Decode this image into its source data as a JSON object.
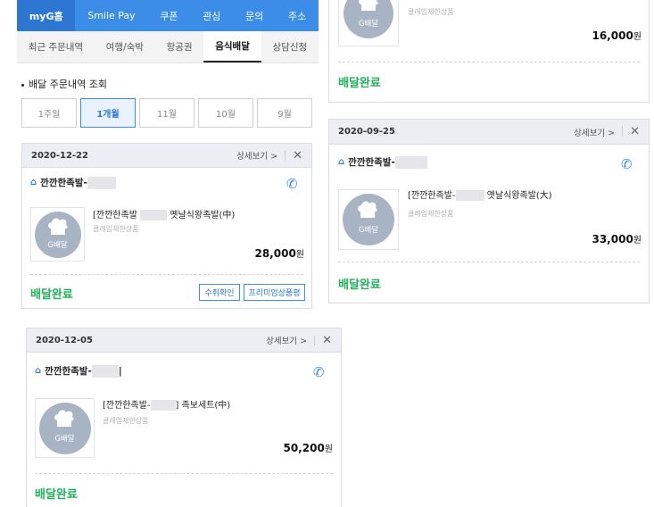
{
  "nav": {
    "tabs": [
      {
        "label": "myG홈",
        "active": true
      },
      {
        "label": "Smile Pay",
        "active": false
      },
      {
        "label": "쿠폰",
        "active": false
      },
      {
        "label": "관심",
        "active": false
      },
      {
        "label": "문의",
        "active": false
      },
      {
        "label": "주소",
        "active": false
      }
    ]
  },
  "subtabs": [
    {
      "label": "최근 주문내역",
      "active": false
    },
    {
      "label": "여행/숙박",
      "active": false
    },
    {
      "label": "항공권",
      "active": false
    },
    {
      "label": "음식배달",
      "active": true
    },
    {
      "label": "상담신청",
      "active": false
    }
  ],
  "section_title": "배달 주문내역 조회",
  "periods": [
    {
      "label": "1주일",
      "active": false
    },
    {
      "label": "1개월",
      "active": true
    },
    {
      "label": "11월",
      "active": false
    },
    {
      "label": "10월",
      "active": false
    },
    {
      "label": "9월",
      "active": false
    }
  ],
  "common": {
    "detail_label": "상세보기 >",
    "close_icon": "✕",
    "sub_label": "클레임제한상품",
    "thumb_label": "G배달",
    "won": "원",
    "status_delivered": "배달완료",
    "colors": {
      "accent": "#3b8de8",
      "delivered": "#21b05a"
    }
  },
  "orders": [
    {
      "date": "",
      "store": "",
      "product": "",
      "price": "16,000",
      "status": "배달완료",
      "buttons": []
    },
    {
      "date": "2020-09-25",
      "store": "깐깐한족발-",
      "product_prefix": "[깐깐한족발-",
      "product_suffix": "옛날식왕족발(大)",
      "price": "33,000",
      "status": "배달완료",
      "buttons": []
    },
    {
      "date": "2020-12-22",
      "store": "깐깐한족발-",
      "product_prefix": "[깐깐한족발",
      "product_suffix": "옛날식왕족발(中)",
      "price": "28,000",
      "status": "배달완료",
      "buttons": [
        "수취확인",
        "프리미엄상품평"
      ]
    },
    {
      "date": "2020-12-05",
      "store": "깐깐한족발-",
      "store_suffix": "|",
      "product_prefix": "[깐깐한족발-",
      "product_suffix": "] 족보세트(中)",
      "price": "50,200",
      "status": "배달완료",
      "buttons": []
    }
  ]
}
